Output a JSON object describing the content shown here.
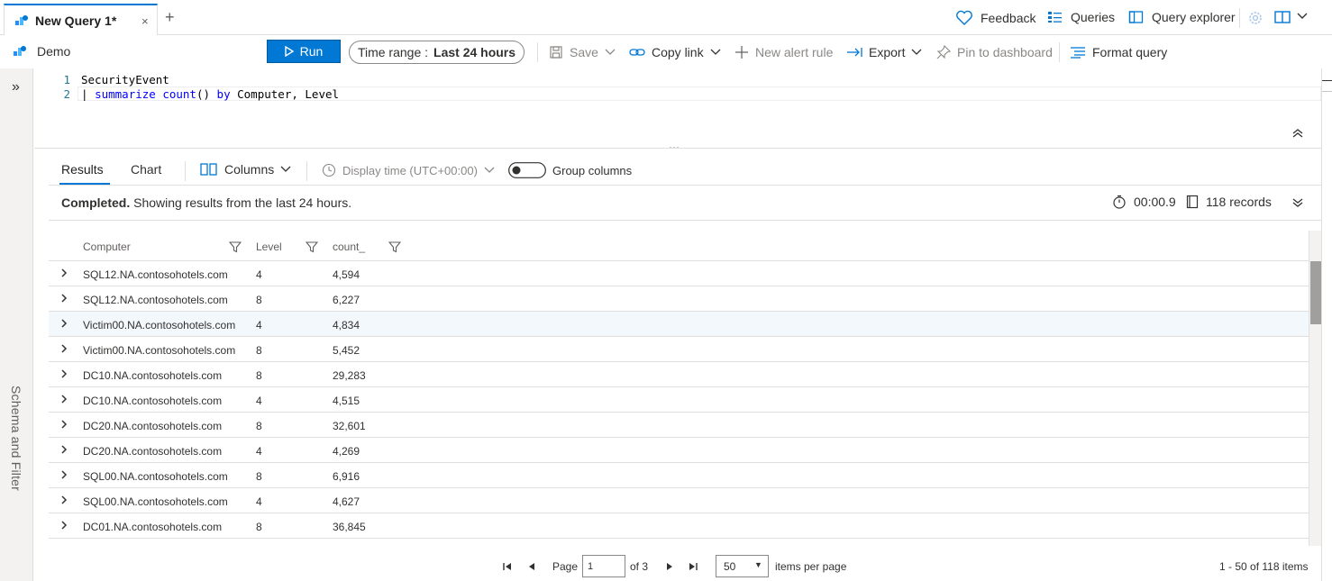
{
  "tab": {
    "title": "New Query 1*",
    "close": "×",
    "add": "+"
  },
  "top_actions": {
    "feedback": "Feedback",
    "queries": "Queries",
    "query_explorer": "Query explorer"
  },
  "workspace": "Demo",
  "commands": {
    "run": "Run",
    "time_range_label": "Time range :",
    "time_range_value": "Last 24 hours",
    "save": "Save",
    "copy_link": "Copy link",
    "new_alert_rule": "New alert rule",
    "export": "Export",
    "pin_to_dashboard": "Pin to dashboard",
    "format_query": "Format query"
  },
  "side_panel_label": "Schema and Filter",
  "editor": {
    "lines": [
      {
        "num": "1",
        "tokens": [
          {
            "text": "SecurityEvent",
            "kind": "plain"
          }
        ]
      },
      {
        "num": "2",
        "tokens": [
          {
            "text": "| ",
            "kind": "plain"
          },
          {
            "text": "summarize",
            "kind": "kw"
          },
          {
            "text": " ",
            "kind": "plain"
          },
          {
            "text": "count",
            "kind": "fn"
          },
          {
            "text": "() ",
            "kind": "plain"
          },
          {
            "text": "by",
            "kind": "kw"
          },
          {
            "text": " Computer, Level",
            "kind": "plain"
          }
        ]
      }
    ]
  },
  "results_toolbar": {
    "tabs": [
      "Results",
      "Chart"
    ],
    "columns": "Columns",
    "display_time": "Display time (UTC+00:00)",
    "group_columns": "Group columns",
    "group_columns_on": false
  },
  "status": {
    "completed": "Completed.",
    "message": " Showing results from the last 24 hours.",
    "duration": "00:00.9",
    "records": "118 records"
  },
  "grid": {
    "columns": [
      "Computer",
      "Level",
      "count_"
    ],
    "rows": [
      [
        "SQL12.NA.contosohotels.com",
        "4",
        "4,594"
      ],
      [
        "SQL12.NA.contosohotels.com",
        "8",
        "6,227"
      ],
      [
        "Victim00.NA.contosohotels.com",
        "4",
        "4,834"
      ],
      [
        "Victim00.NA.contosohotels.com",
        "8",
        "5,452"
      ],
      [
        "DC10.NA.contosohotels.com",
        "8",
        "29,283"
      ],
      [
        "DC10.NA.contosohotels.com",
        "4",
        "4,515"
      ],
      [
        "DC20.NA.contosohotels.com",
        "8",
        "32,601"
      ],
      [
        "DC20.NA.contosohotels.com",
        "4",
        "4,269"
      ],
      [
        "SQL00.NA.contosohotels.com",
        "8",
        "6,916"
      ],
      [
        "SQL00.NA.contosohotels.com",
        "4",
        "4,627"
      ],
      [
        "DC01.NA.contosohotels.com",
        "8",
        "36,845"
      ]
    ],
    "selected_row": 2
  },
  "pager": {
    "page_label": "Page",
    "page_value": "1",
    "of_label": "of 3",
    "per_page": "50",
    "items_per_page": "items per page",
    "range": "1 - 50 of 118 items"
  },
  "colors": {
    "accent": "#0078d4",
    "border": "#e1dfdd",
    "selected_row": "#f3f8fd"
  }
}
